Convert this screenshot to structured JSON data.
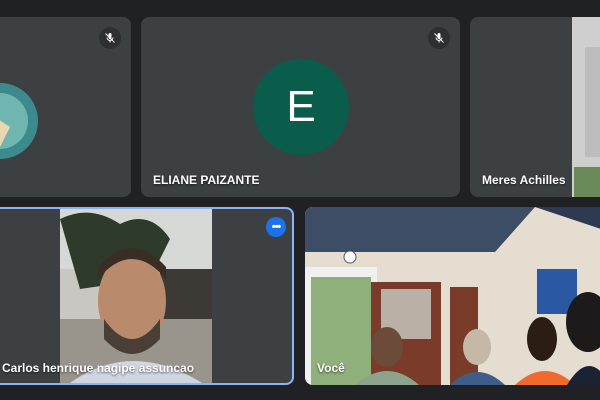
{
  "colors": {
    "background": "#202124",
    "tile": "#3c4043",
    "active_border": "#8ab4f8",
    "avatar_e": "#0b5d4b",
    "more_button": "#1a73e8"
  },
  "participants": [
    {
      "name": "",
      "muted": true,
      "display": "video"
    },
    {
      "name": "ELIANE PAIZANTE",
      "muted": true,
      "initial": "E",
      "display": "avatar"
    },
    {
      "name": "Meres Achilles",
      "muted": false,
      "display": "video"
    },
    {
      "name": "Carlos henrique nagipe assuncao",
      "muted": false,
      "display": "video",
      "active": true
    },
    {
      "name": "Você",
      "muted": false,
      "display": "video"
    }
  ],
  "icons": {
    "mic_off": "mic-off-icon",
    "more": "more-options-icon"
  }
}
